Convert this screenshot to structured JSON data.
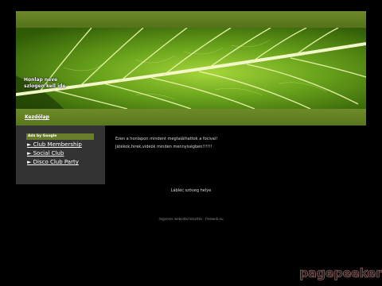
{
  "header": {
    "site_name_line1": "Honlap neve",
    "site_name_line2": "szlogen kell ide"
  },
  "nav": {
    "home_label": "Kezdőlap"
  },
  "sidebar": {
    "ads_header": "Ads by Google",
    "ads": [
      {
        "label": "► Club Membership"
      },
      {
        "label": "► Social Club"
      },
      {
        "label": "► Disco Club Party"
      }
    ]
  },
  "content": {
    "line1": "Ezen a honlapon mindent megtalálhattok a focival!",
    "line2": "Játékok,hirek,videók minden mennyiségben!!!!!!"
  },
  "footer": {
    "text": "Lábléc szöveg helye",
    "credit": "Ingyenes weboldal készítés - freeweb.eu"
  },
  "watermark": "pagepeeker",
  "colors": {
    "background": "#000000",
    "bar_green": "#627f22",
    "sidebar_bg": "#333333",
    "leaf_green": "#4a7a12"
  }
}
